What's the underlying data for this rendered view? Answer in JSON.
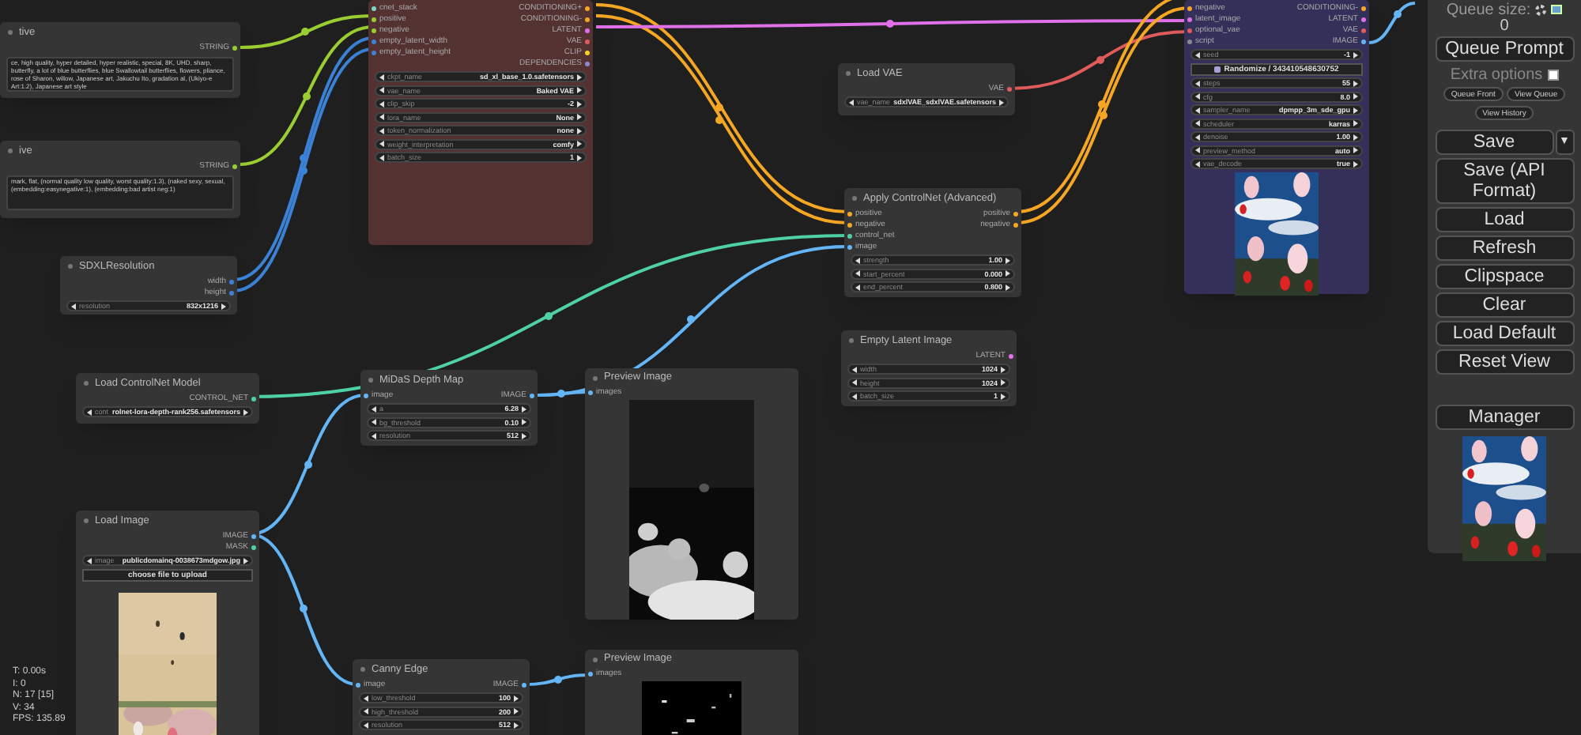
{
  "nodes": [
    {
      "title": "tive",
      "outputs": [
        {
          "label": "STRING",
          "color": "#9acd32"
        }
      ],
      "text": "ce, high quality, hyper detailed, hyper realistic, special, 8K, UHD, sharp, butterfly, a lot of blue butterflies, blue Swallowtail butterflies, flowers, pliance, rose of Sharon, willow, Japanese art, Jakuchu Ito, gradation al, (Ukiyo-e Art:1.2), Japanese art style"
    },
    {
      "title": "ive",
      "outputs": [
        {
          "label": "STRING",
          "color": "#9acd32"
        }
      ],
      "text": "mark, flat, (normal quality low quality, worst quality:1.3), (naked sexy, sexual, (embedding:easynegative:1), (embedding:bad artist neg:1)"
    },
    {
      "title": "SDXLResolution",
      "outputs": [
        {
          "label": "width",
          "color": "#3b82d6"
        },
        {
          "label": "height",
          "color": "#3b82d6"
        }
      ],
      "widgets": [
        {
          "label": "resolution",
          "value": "832x1216"
        }
      ]
    },
    {
      "color": "#553232",
      "inputs": [
        {
          "label": "cnet_stack",
          "color": "#7fd4c5"
        },
        {
          "label": "positive",
          "color": "#9acd32"
        },
        {
          "label": "negative",
          "color": "#9acd32"
        },
        {
          "label": "empty_latent_width",
          "color": "#3b82d6"
        },
        {
          "label": "empty_latent_height",
          "color": "#3b82d6"
        }
      ],
      "outputs": [
        {
          "label": "CONDITIONING+",
          "color": "#f5a623"
        },
        {
          "label": "CONDITIONING-",
          "color": "#f5a623"
        },
        {
          "label": "LATENT",
          "color": "#e070e8"
        },
        {
          "label": "VAE",
          "color": "#e05c5c"
        },
        {
          "label": "CLIP",
          "color": "#f5d020"
        },
        {
          "label": "DEPENDENCIES",
          "color": "#8a8ad0"
        }
      ],
      "widgets": [
        {
          "label": "ckpt_name",
          "value": "sd_xl_base_1.0.safetensors"
        },
        {
          "label": "vae_name",
          "value": "Baked VAE"
        },
        {
          "label": "clip_skip",
          "value": "-2"
        },
        {
          "label": "lora_name",
          "value": "None"
        },
        {
          "label": "token_normalization",
          "value": "none"
        },
        {
          "label": "weight_interpretation",
          "value": "comfy"
        },
        {
          "label": "batch_size",
          "value": "1"
        }
      ]
    },
    {
      "title": "Load VAE",
      "outputs": [
        {
          "label": "VAE",
          "color": "#e05c5c"
        }
      ],
      "widgets": [
        {
          "label": "vae_name",
          "value": "sdxlVAE_sdxlVAE.safetensors"
        }
      ]
    },
    {
      "title": "Apply ControlNet (Advanced)",
      "inputs": [
        {
          "label": "positive",
          "color": "#f5a623"
        },
        {
          "label": "negative",
          "color": "#f5a623"
        },
        {
          "label": "control_net",
          "color": "#4fd1a5"
        },
        {
          "label": "image",
          "color": "#64b5f6"
        }
      ],
      "outputs": [
        {
          "label": "positive",
          "color": "#f5a623"
        },
        {
          "label": "negative",
          "color": "#f5a623"
        }
      ],
      "widgets": [
        {
          "label": "strength",
          "value": "1.00"
        },
        {
          "label": "start_percent",
          "value": "0.000"
        },
        {
          "label": "end_percent",
          "value": "0.800"
        }
      ]
    },
    {
      "title": "Empty Latent Image",
      "outputs": [
        {
          "label": "LATENT",
          "color": "#e070e8"
        }
      ],
      "widgets": [
        {
          "label": "width",
          "value": "1024"
        },
        {
          "label": "height",
          "value": "1024"
        },
        {
          "label": "batch_size",
          "value": "1"
        }
      ]
    },
    {
      "color": "#34305a",
      "inputs": [
        {
          "label": "negative",
          "color": "#f5a623"
        },
        {
          "label": "latent_image",
          "color": "#e070e8"
        },
        {
          "label": "optional_vae",
          "color": "#e05c5c"
        },
        {
          "label": "script",
          "color": "#8a8a8a"
        }
      ],
      "outputs": [
        {
          "label": "CONDITIONING-",
          "color": "#f5a623"
        },
        {
          "label": "LATENT",
          "color": "#e070e8"
        },
        {
          "label": "VAE",
          "color": "#e05c5c"
        },
        {
          "label": "IMAGE",
          "color": "#64b5f6"
        }
      ],
      "widgets": [
        {
          "label": "seed",
          "value": "-1"
        }
      ],
      "buttons": [
        "Randomize / 343410548630752"
      ],
      "widgets_after": [
        {
          "label": "steps",
          "value": "55"
        },
        {
          "label": "cfg",
          "value": "8.0"
        },
        {
          "label": "sampler_name",
          "value": "dpmpp_3m_sde_gpu"
        },
        {
          "label": "scheduler",
          "value": "karras"
        },
        {
          "label": "denoise",
          "value": "1.00"
        },
        {
          "label": "preview_method",
          "value": "auto"
        },
        {
          "label": "vae_decode",
          "value": "true"
        }
      ],
      "image": {
        "kind": "picture"
      }
    },
    {
      "title": "Load ControlNet Model",
      "outputs": [
        {
          "label": "CONTROL_NET",
          "color": "#4fd1a5"
        }
      ],
      "widgets": [
        {
          "label": "cont",
          "value": "rolnet-lora-depth-rank256.safetensors"
        }
      ]
    },
    {
      "title": "MiDaS Depth Map",
      "inputs": [
        {
          "label": "image",
          "color": "#64b5f6"
        }
      ],
      "outputs": [
        {
          "label": "IMAGE",
          "color": "#64b5f6"
        }
      ],
      "widgets": [
        {
          "label": "a",
          "value": "6.28"
        },
        {
          "label": "bg_threshold",
          "value": "0.10"
        },
        {
          "label": "resolution",
          "value": "512"
        }
      ]
    },
    {
      "title": "Preview Image",
      "inputs": [
        {
          "label": "images",
          "color": "#64b5f6"
        }
      ],
      "image": {
        "kind": "picture"
      }
    },
    {
      "title": "Load Image",
      "outputs": [
        {
          "label": "IMAGE",
          "color": "#64b5f6"
        },
        {
          "label": "MASK",
          "color": "#4fd1a5"
        }
      ],
      "widgets": [
        {
          "label": "image",
          "value": "publicdomainq-0038673mdgow.jpg"
        }
      ],
      "buttons": [
        "choose file to upload"
      ],
      "image": {
        "kind": "picture"
      }
    },
    {
      "title": "Canny Edge",
      "inputs": [
        {
          "label": "image",
          "color": "#64b5f6"
        }
      ],
      "outputs": [
        {
          "label": "IMAGE",
          "color": "#64b5f6"
        }
      ],
      "widgets": [
        {
          "label": "low_threshold",
          "value": "100"
        },
        {
          "label": "high_threshold",
          "value": "200"
        },
        {
          "label": "resolution",
          "value": "512"
        }
      ]
    },
    {
      "title": "Preview Image",
      "inputs": [
        {
          "label": "images",
          "color": "#64b5f6"
        }
      ],
      "image": {
        "kind": "picture"
      }
    }
  ],
  "stats": [
    "T: 0.00s",
    "I: 0",
    "N: 17 [15]",
    "V: 34",
    "FPS: 135.89"
  ],
  "panel": {
    "queue_label": "Queue size:",
    "queue_count": "0",
    "queue_button": "Queue Prompt",
    "extra_options": {
      "label": "Extra options",
      "checked": false
    },
    "small_buttons": [
      "Queue Front",
      "View Queue",
      "View History"
    ],
    "save": {
      "label": "Save",
      "dropdown": "▼"
    },
    "buttons": [
      "Save (API Format)",
      "Load",
      "Refresh",
      "Clipspace",
      "Clear",
      "Load Default",
      "Reset View"
    ],
    "manager": "Manager",
    "image": {
      "kind": "picture"
    }
  }
}
